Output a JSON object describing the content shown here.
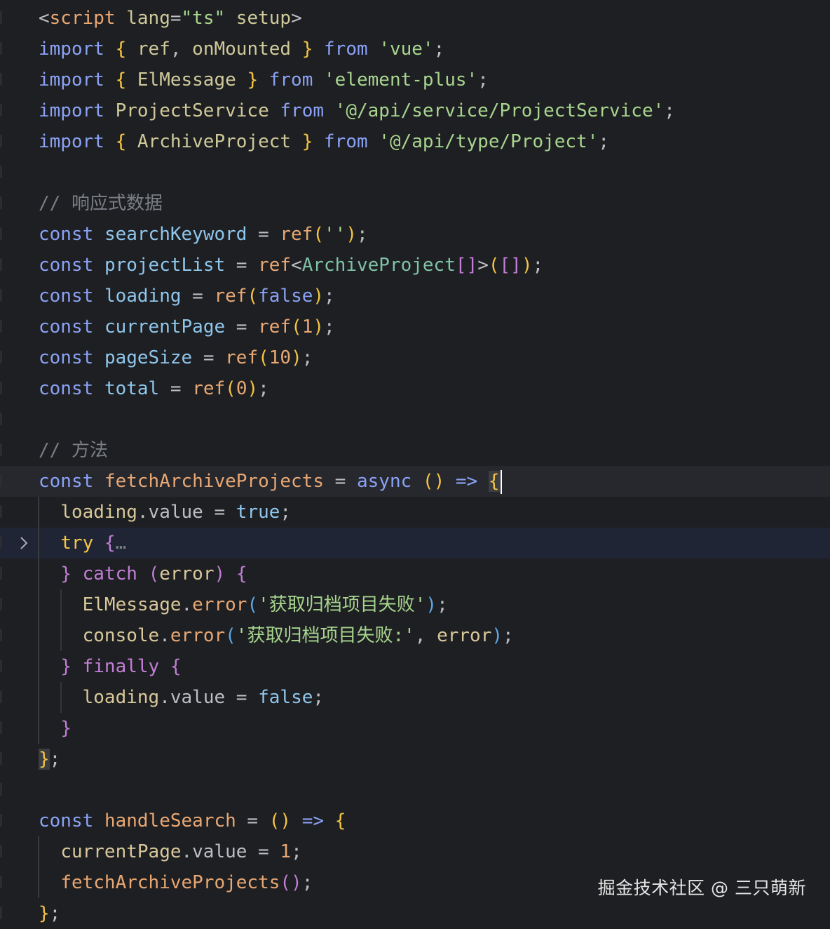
{
  "theme": {
    "background": "#1e1f22",
    "current_line": "#26282e",
    "folded_line": "#202536",
    "colors": {
      "keyword": "#8aa2f5",
      "tag": "#bcbec4",
      "attr": "#cfc99a",
      "string": "#a7d58e",
      "variable": "#8fc6ec",
      "func": "#e8a773",
      "text": "#bcbec4",
      "punct": "#bcbec4",
      "paren_yellow": "#f5c542",
      "paren_pink": "#c27ed6",
      "paren_blue": "#5fa8e8",
      "comment": "#7a7e85",
      "number": "#e8a773",
      "type": "#7fc2a6",
      "property": "#d8c89a"
    }
  },
  "editor": {
    "lines": [
      {
        "tokens": [
          [
            "<",
            "tag"
          ],
          [
            "script",
            "func"
          ],
          [
            " ",
            "text"
          ],
          [
            "lang",
            "attr"
          ],
          [
            "=",
            "text"
          ],
          [
            "\"ts\"",
            "string"
          ],
          [
            " ",
            "text"
          ],
          [
            "setup",
            "attr"
          ],
          [
            ">",
            "tag"
          ]
        ]
      },
      {
        "tokens": [
          [
            "import",
            "keyword"
          ],
          [
            " ",
            "text"
          ],
          [
            "{",
            "paren_yellow"
          ],
          [
            " ",
            "text"
          ],
          [
            "ref",
            "attr"
          ],
          [
            ", ",
            "text"
          ],
          [
            "onMounted",
            "attr"
          ],
          [
            " ",
            "text"
          ],
          [
            "}",
            "paren_yellow"
          ],
          [
            " ",
            "text"
          ],
          [
            "from",
            "keyword"
          ],
          [
            " ",
            "text"
          ],
          [
            "'vue'",
            "string"
          ],
          [
            ";",
            "text"
          ]
        ]
      },
      {
        "tokens": [
          [
            "import",
            "keyword"
          ],
          [
            " ",
            "text"
          ],
          [
            "{",
            "paren_yellow"
          ],
          [
            " ",
            "text"
          ],
          [
            "ElMessage",
            "attr"
          ],
          [
            " ",
            "text"
          ],
          [
            "}",
            "paren_yellow"
          ],
          [
            " ",
            "text"
          ],
          [
            "from",
            "keyword"
          ],
          [
            " ",
            "text"
          ],
          [
            "'element-plus'",
            "string"
          ],
          [
            ";",
            "text"
          ]
        ]
      },
      {
        "tokens": [
          [
            "import",
            "keyword"
          ],
          [
            " ",
            "text"
          ],
          [
            "ProjectService",
            "attr"
          ],
          [
            " ",
            "text"
          ],
          [
            "from",
            "keyword"
          ],
          [
            " ",
            "text"
          ],
          [
            "'@/api/service/ProjectService'",
            "string"
          ],
          [
            ";",
            "text"
          ]
        ]
      },
      {
        "tokens": [
          [
            "import",
            "keyword"
          ],
          [
            " ",
            "text"
          ],
          [
            "{",
            "paren_yellow"
          ],
          [
            " ",
            "text"
          ],
          [
            "ArchiveProject",
            "attr"
          ],
          [
            " ",
            "text"
          ],
          [
            "}",
            "paren_yellow"
          ],
          [
            " ",
            "text"
          ],
          [
            "from",
            "keyword"
          ],
          [
            " ",
            "text"
          ],
          [
            "'@/api/type/Project'",
            "string"
          ],
          [
            ";",
            "text"
          ]
        ]
      },
      {
        "tokens": []
      },
      {
        "tokens": [
          [
            "// 响应式数据",
            "comment"
          ]
        ]
      },
      {
        "tokens": [
          [
            "const",
            "keyword"
          ],
          [
            " ",
            "text"
          ],
          [
            "searchKeyword",
            "variable"
          ],
          [
            " = ",
            "text"
          ],
          [
            "ref",
            "func"
          ],
          [
            "(",
            "paren_yellow"
          ],
          [
            "''",
            "string"
          ],
          [
            ")",
            "paren_yellow"
          ],
          [
            ";",
            "text"
          ]
        ]
      },
      {
        "tokens": [
          [
            "const",
            "keyword"
          ],
          [
            " ",
            "text"
          ],
          [
            "projectList",
            "variable"
          ],
          [
            " = ",
            "text"
          ],
          [
            "ref",
            "func"
          ],
          [
            "<",
            "text"
          ],
          [
            "ArchiveProject",
            "type"
          ],
          [
            "[]",
            "paren_pink"
          ],
          [
            ">",
            "text"
          ],
          [
            "(",
            "paren_yellow"
          ],
          [
            "[]",
            "paren_pink"
          ],
          [
            ")",
            "paren_yellow"
          ],
          [
            ";",
            "text"
          ]
        ]
      },
      {
        "tokens": [
          [
            "const",
            "keyword"
          ],
          [
            " ",
            "text"
          ],
          [
            "loading",
            "variable"
          ],
          [
            " = ",
            "text"
          ],
          [
            "ref",
            "func"
          ],
          [
            "(",
            "paren_yellow"
          ],
          [
            "false",
            "keyword"
          ],
          [
            ")",
            "paren_yellow"
          ],
          [
            ";",
            "text"
          ]
        ]
      },
      {
        "tokens": [
          [
            "const",
            "keyword"
          ],
          [
            " ",
            "text"
          ],
          [
            "currentPage",
            "variable"
          ],
          [
            " = ",
            "text"
          ],
          [
            "ref",
            "func"
          ],
          [
            "(",
            "paren_yellow"
          ],
          [
            "1",
            "number"
          ],
          [
            ")",
            "paren_yellow"
          ],
          [
            ";",
            "text"
          ]
        ]
      },
      {
        "tokens": [
          [
            "const",
            "keyword"
          ],
          [
            " ",
            "text"
          ],
          [
            "pageSize",
            "variable"
          ],
          [
            " = ",
            "text"
          ],
          [
            "ref",
            "func"
          ],
          [
            "(",
            "paren_yellow"
          ],
          [
            "10",
            "number"
          ],
          [
            ")",
            "paren_yellow"
          ],
          [
            ";",
            "text"
          ]
        ]
      },
      {
        "tokens": [
          [
            "const",
            "keyword"
          ],
          [
            " ",
            "text"
          ],
          [
            "total",
            "variable"
          ],
          [
            " = ",
            "text"
          ],
          [
            "ref",
            "func"
          ],
          [
            "(",
            "paren_yellow"
          ],
          [
            "0",
            "number"
          ],
          [
            ")",
            "paren_yellow"
          ],
          [
            ";",
            "text"
          ]
        ]
      },
      {
        "tokens": []
      },
      {
        "tokens": [
          [
            "// 方法",
            "comment"
          ]
        ]
      },
      {
        "state": "current",
        "tokens": [
          [
            "const",
            "keyword"
          ],
          [
            " ",
            "text"
          ],
          [
            "fetchArchiveProjects",
            "func"
          ],
          [
            " = ",
            "text"
          ],
          [
            "async",
            "keyword"
          ],
          [
            " ",
            "text"
          ],
          [
            "()",
            "paren_yellow"
          ],
          [
            " ",
            "text"
          ],
          [
            "=>",
            "keyword"
          ],
          [
            " ",
            "text"
          ],
          [
            "{",
            "paren_yellow_hl"
          ],
          [
            "|",
            "caret"
          ]
        ]
      },
      {
        "tokens": [
          [
            "  ",
            "text"
          ],
          [
            "loading",
            "property"
          ],
          [
            ".",
            "text"
          ],
          [
            "value",
            "text"
          ],
          [
            " = ",
            "text"
          ],
          [
            "true",
            "variable"
          ],
          [
            ";",
            "text"
          ]
        ]
      },
      {
        "state": "folded",
        "tokens": [
          [
            "  ",
            "text"
          ],
          [
            "try",
            "keyword_y"
          ],
          [
            " ",
            "text"
          ],
          [
            "{",
            "paren_pink"
          ],
          [
            "…",
            "ellipsis"
          ]
        ]
      },
      {
        "tokens": [
          [
            "  ",
            "text"
          ],
          [
            "}",
            "paren_pink"
          ],
          [
            " ",
            "text"
          ],
          [
            "catch",
            "paren_pink"
          ],
          [
            " ",
            "text"
          ],
          [
            "(",
            "paren_pink"
          ],
          [
            "error",
            "property"
          ],
          [
            ")",
            "paren_pink"
          ],
          [
            " ",
            "text"
          ],
          [
            "{",
            "paren_pink"
          ]
        ]
      },
      {
        "tokens": [
          [
            "    ",
            "text"
          ],
          [
            "ElMessage",
            "property"
          ],
          [
            ".",
            "text"
          ],
          [
            "error",
            "func"
          ],
          [
            "(",
            "paren_blue"
          ],
          [
            "'获取归档项目失败'",
            "string"
          ],
          [
            ")",
            "paren_blue"
          ],
          [
            ";",
            "text"
          ]
        ]
      },
      {
        "tokens": [
          [
            "    ",
            "text"
          ],
          [
            "console",
            "property"
          ],
          [
            ".",
            "text"
          ],
          [
            "error",
            "func"
          ],
          [
            "(",
            "paren_blue"
          ],
          [
            "'获取归档项目失败:'",
            "string"
          ],
          [
            ", ",
            "text"
          ],
          [
            "error",
            "property"
          ],
          [
            ")",
            "paren_blue"
          ],
          [
            ";",
            "text"
          ]
        ]
      },
      {
        "tokens": [
          [
            "  ",
            "text"
          ],
          [
            "}",
            "paren_pink"
          ],
          [
            " ",
            "text"
          ],
          [
            "finally",
            "paren_pink"
          ],
          [
            " ",
            "text"
          ],
          [
            "{",
            "paren_pink"
          ]
        ]
      },
      {
        "tokens": [
          [
            "    ",
            "text"
          ],
          [
            "loading",
            "property"
          ],
          [
            ".",
            "text"
          ],
          [
            "value",
            "text"
          ],
          [
            " = ",
            "text"
          ],
          [
            "false",
            "variable"
          ],
          [
            ";",
            "text"
          ]
        ]
      },
      {
        "tokens": [
          [
            "  ",
            "text"
          ],
          [
            "}",
            "paren_pink"
          ]
        ]
      },
      {
        "tokens": [
          [
            "}",
            "paren_yellow_hl"
          ],
          [
            ";",
            "text"
          ]
        ]
      },
      {
        "tokens": []
      },
      {
        "tokens": [
          [
            "const",
            "keyword"
          ],
          [
            " ",
            "text"
          ],
          [
            "handleSearch",
            "func"
          ],
          [
            " = ",
            "text"
          ],
          [
            "()",
            "paren_yellow"
          ],
          [
            " ",
            "text"
          ],
          [
            "=>",
            "keyword"
          ],
          [
            " ",
            "text"
          ],
          [
            "{",
            "paren_yellow"
          ]
        ]
      },
      {
        "tokens": [
          [
            "  ",
            "text"
          ],
          [
            "currentPage",
            "property"
          ],
          [
            ".",
            "text"
          ],
          [
            "value",
            "text"
          ],
          [
            " = ",
            "text"
          ],
          [
            "1",
            "number"
          ],
          [
            ";",
            "text"
          ]
        ]
      },
      {
        "tokens": [
          [
            "  ",
            "text"
          ],
          [
            "fetchArchiveProjects",
            "func"
          ],
          [
            "()",
            "paren_pink"
          ],
          [
            ";",
            "text"
          ]
        ]
      },
      {
        "tokens": [
          [
            "}",
            "paren_yellow"
          ],
          [
            ";",
            "text"
          ]
        ]
      }
    ]
  },
  "watermark": {
    "text": "掘金技术社区 @ 三只萌新"
  }
}
